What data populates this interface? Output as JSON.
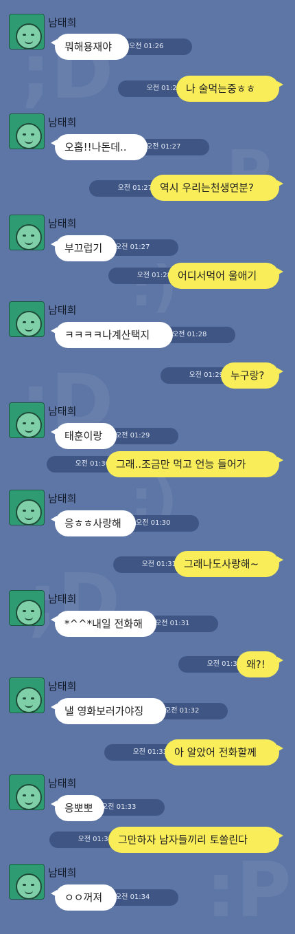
{
  "sender": {
    "name": "남태희"
  },
  "messages": [
    {
      "dir": "in",
      "text": "뭐해용재야",
      "time": "오전 01:26"
    },
    {
      "dir": "out",
      "text": "나 술먹는중ㅎㅎ",
      "time": "오전 01:27"
    },
    {
      "dir": "in",
      "text": "오홉!!나돈데..",
      "time": "오전 01:27"
    },
    {
      "dir": "out",
      "text": "역시 우리는천생연분?",
      "time": "오전 01:27"
    },
    {
      "dir": "in",
      "text": "부끄럽기",
      "time": "오전 01:27"
    },
    {
      "dir": "out",
      "text": "어디서먹어 울애기",
      "time": "오전 01:28"
    },
    {
      "dir": "in",
      "text": "ㅋㅋㅋㅋ나계산택지",
      "time": "오전 01:28"
    },
    {
      "dir": "out",
      "text": "누구랑?",
      "time": "오전 01:29"
    },
    {
      "dir": "in",
      "text": "태훈이랑",
      "time": "오전 01:29"
    },
    {
      "dir": "out",
      "text": "그래..조금만 먹고 언능 들어가",
      "time": "오전 01:30"
    },
    {
      "dir": "in",
      "text": "응ㅎㅎ사랑해",
      "time": "오전 01:30"
    },
    {
      "dir": "out",
      "text": "그래나도사랑해~",
      "time": "오전 01:31"
    },
    {
      "dir": "in",
      "text": "*^^*내일 전화해",
      "time": "오전 01:31"
    },
    {
      "dir": "out",
      "text": "왜?!",
      "time": "오전 01:32"
    },
    {
      "dir": "in",
      "text": "낼 영화보러가야징",
      "time": "오전 01:32"
    },
    {
      "dir": "out",
      "text": "아 알았어 전화할께",
      "time": "오전 01:33"
    },
    {
      "dir": "in",
      "text": "응뽀뽀",
      "time": "오전 01:33"
    },
    {
      "dir": "out",
      "text": "그만하자 남자들끼리 토쏠린다",
      "time": "오전 01:34"
    },
    {
      "dir": "in",
      "text": "ㅇㅇ꺼져",
      "time": "오전 01:34"
    }
  ],
  "colors": {
    "background": "#5d76a6",
    "incoming": "#ffffff",
    "outgoing": "#f9ee5a",
    "timestamp_bg": "#3f5685"
  }
}
